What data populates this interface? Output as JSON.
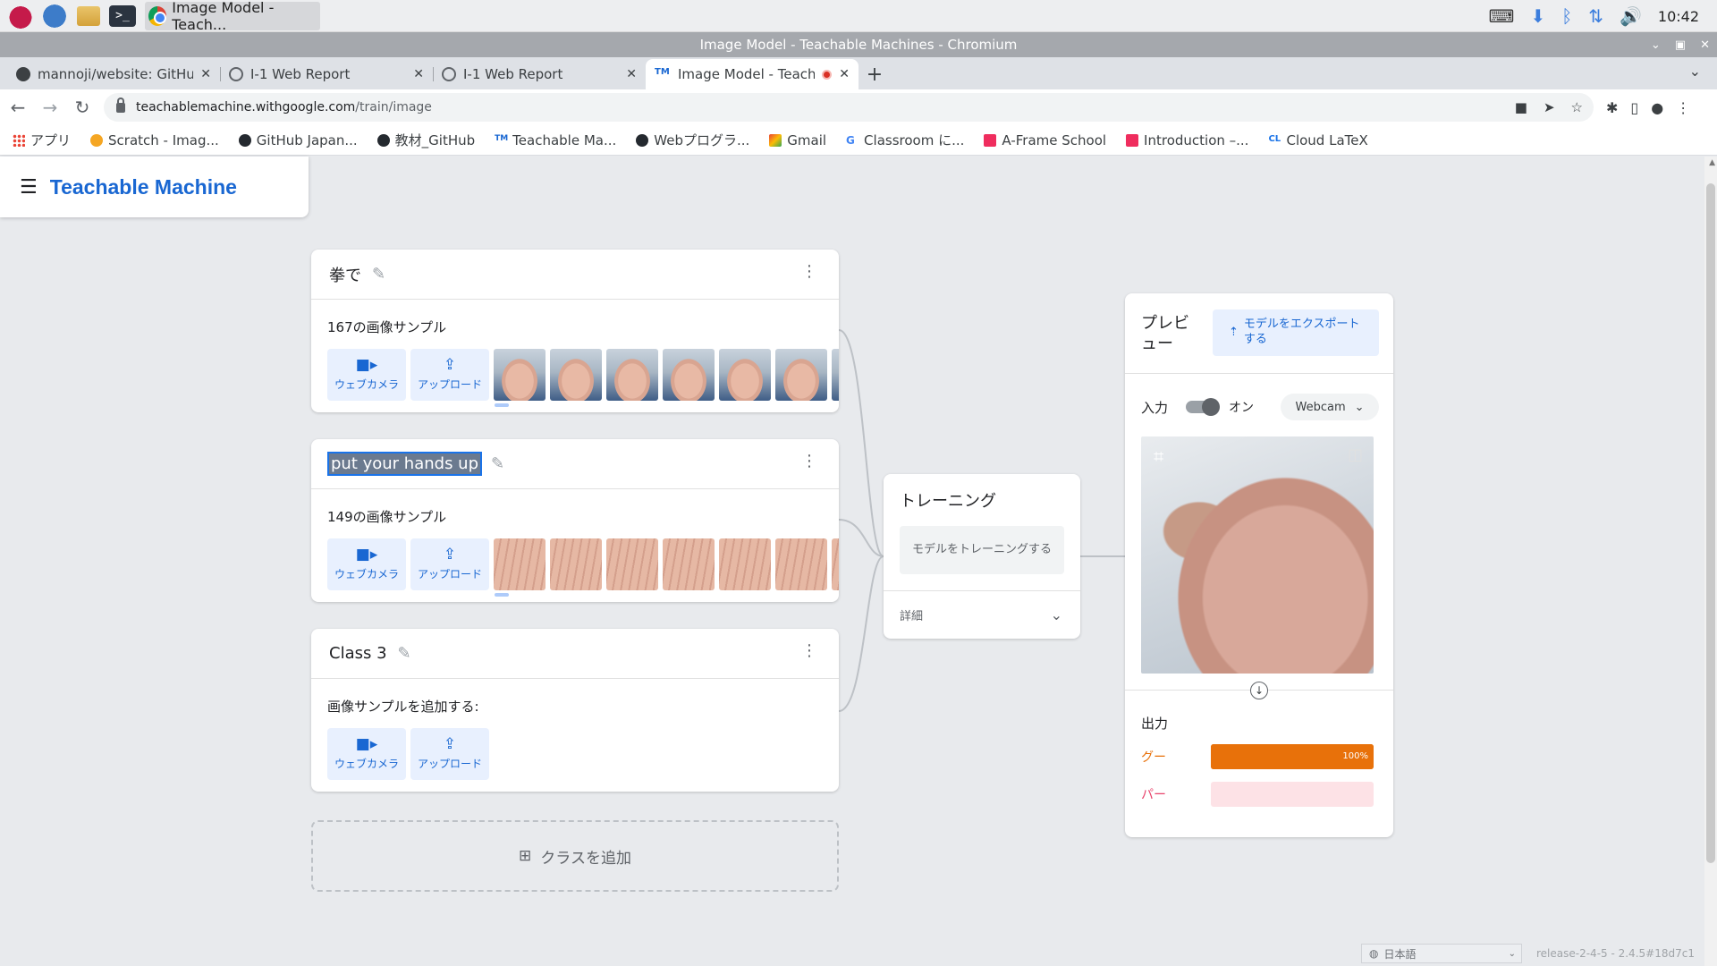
{
  "taskbar": {
    "active_task": "Image Model - Teach...",
    "clock": "10:42"
  },
  "window": {
    "title": "Image Model - Teachable Machines - Chromium"
  },
  "tabs": [
    {
      "title": "mannoji/website: GitHub",
      "favicon": "github-icon"
    },
    {
      "title": "I-1 Web Report",
      "favicon": "globe-icon"
    },
    {
      "title": "I-1 Web Report",
      "favicon": "globe-icon"
    },
    {
      "title": "Image Model - Teach",
      "favicon": "tm-icon",
      "active": true,
      "recording": true
    }
  ],
  "address_bar": {
    "host": "teachablemachine.withgoogle.com",
    "path": "/train/image"
  },
  "bookmarks": [
    {
      "label": "アプリ",
      "icon": "apps-icon"
    },
    {
      "label": "Scratch - Imag...",
      "icon": "scratch-icon"
    },
    {
      "label": "GitHub Japan...",
      "icon": "github-icon"
    },
    {
      "label": "教材_GitHub",
      "icon": "github-icon"
    },
    {
      "label": "Teachable Ma...",
      "icon": "tm-icon",
      "glyph": "TM"
    },
    {
      "label": "Webプログラ...",
      "icon": "globe-icon"
    },
    {
      "label": "Gmail",
      "icon": "gmail-icon"
    },
    {
      "label": "Classroom に...",
      "icon": "google-icon",
      "glyph": "G"
    },
    {
      "label": "A-Frame School",
      "icon": "aframe-icon"
    },
    {
      "label": "Introduction –...",
      "icon": "aframe-icon"
    },
    {
      "label": "Cloud LaTeX",
      "icon": "cloudlatex-icon",
      "glyph": "CL"
    }
  ],
  "app": {
    "title": "Teachable Machine"
  },
  "classes": [
    {
      "name": "拳で",
      "sample_text": "167の画像サンプル",
      "thumb_type": "fist",
      "thumb_count": 7,
      "selected": false
    },
    {
      "name": "put your hands up",
      "sample_text": "149の画像サンプル",
      "thumb_type": "hand",
      "thumb_count": 7,
      "selected": true
    },
    {
      "name": "Class 3",
      "sample_text": "画像サンプルを追加する:",
      "thumb_type": "none",
      "thumb_count": 0,
      "selected": false
    }
  ],
  "source_buttons": {
    "webcam_label": "ウェブカメラ",
    "upload_label": "アップロード"
  },
  "add_class_label": "クラスを追加",
  "training": {
    "title": "トレーニング",
    "button_label": "モデルをトレーニングする",
    "advanced_label": "詳細"
  },
  "preview": {
    "title": "プレビュー",
    "export_label": "モデルをエクスポートする",
    "input_label": "入力",
    "toggle_label": "オン",
    "input_source": "Webcam",
    "output_label": "出力",
    "outputs": [
      {
        "name": "グー",
        "percent": 100,
        "percent_text": "100%",
        "color": "#e8710a",
        "track": "#e8710a"
      },
      {
        "name": "パー",
        "percent": 0,
        "percent_text": "",
        "color": "#e8436b",
        "track": "#fde2e6"
      }
    ]
  },
  "footer": {
    "language": "日本語",
    "release": "release-2-4-5 - 2.4.5#18d7c1"
  }
}
